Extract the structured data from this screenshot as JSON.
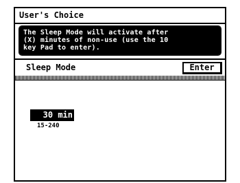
{
  "window": {
    "title": "User's Choice"
  },
  "message": {
    "lines": [
      "The Sleep Mode will activate after",
      "(X) minutes of non-use (use the 10",
      "key Pad to enter)."
    ]
  },
  "setting": {
    "label": "Sleep Mode",
    "enter_label": "Enter",
    "value": "30 min",
    "range": "15-240"
  },
  "colors": {
    "background": "#ffffff",
    "foreground": "#000000",
    "highlight": "#000000"
  }
}
